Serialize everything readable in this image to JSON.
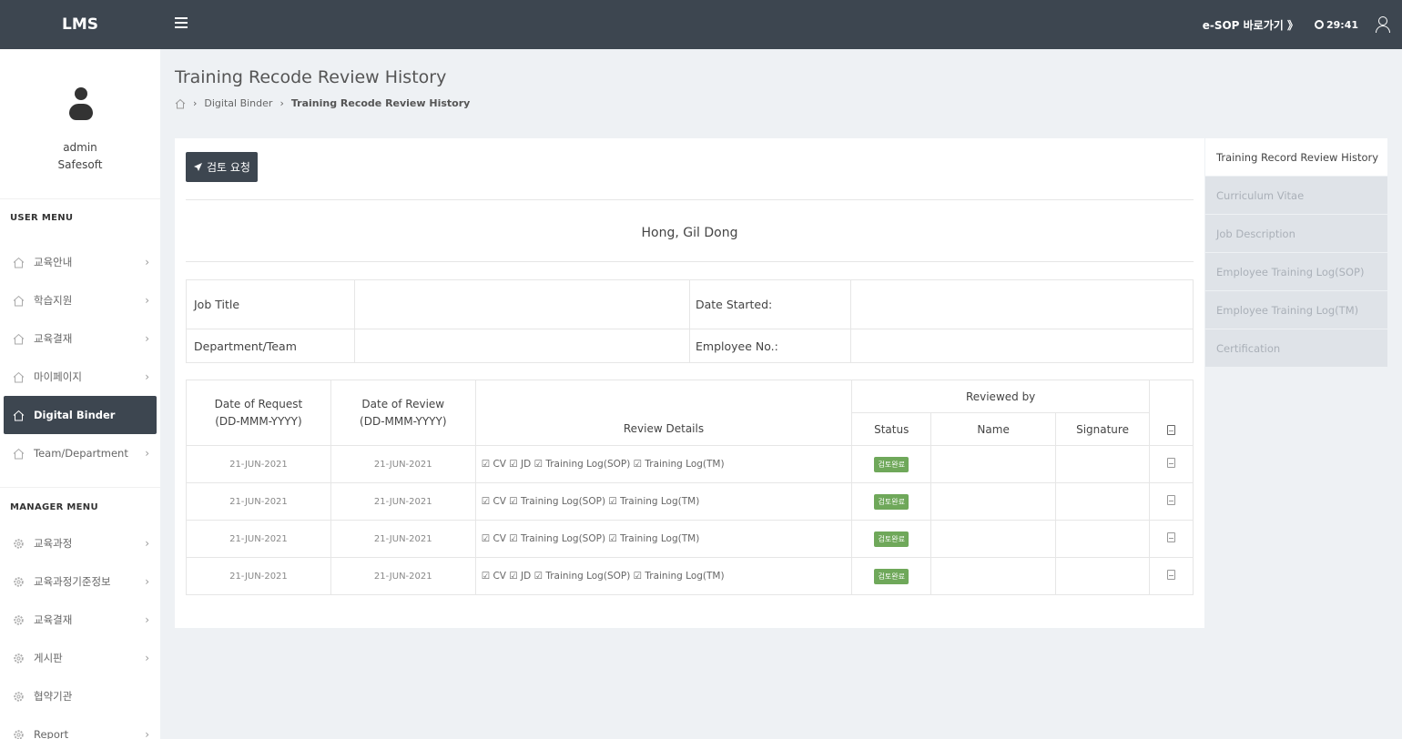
{
  "topbar": {
    "brand": "LMS",
    "esop_link": "e-SOP 바로가기 》",
    "timer": "29:41"
  },
  "sidebar": {
    "profile": {
      "name": "admin",
      "org": "Safesoft"
    },
    "user_menu_title": "USER MENU",
    "user_items": [
      {
        "label": "교육안내",
        "arrow": "›"
      },
      {
        "label": "학습지원",
        "arrow": "›"
      },
      {
        "label": "교육결재",
        "arrow": "›"
      },
      {
        "label": "마이페이지",
        "arrow": "›"
      },
      {
        "label": "Digital Binder",
        "active": true
      },
      {
        "label": "Team/Department",
        "arrow": "›"
      }
    ],
    "manager_menu_title": "MANAGER MENU",
    "manager_items": [
      {
        "label": "교육과정",
        "arrow": "›"
      },
      {
        "label": "교육과정기준정보",
        "arrow": "›"
      },
      {
        "label": "교육결재",
        "arrow": "›"
      },
      {
        "label": "게시판",
        "arrow": "›"
      },
      {
        "label": "협약기관"
      },
      {
        "label": "Report",
        "arrow": "›"
      }
    ]
  },
  "page": {
    "title": "Training Recode Review History",
    "breadcrumb": [
      "Digital Binder",
      "Training Recode Review History"
    ]
  },
  "card": {
    "request_button": "검토 요청",
    "employee_name": "Hong, Gil Dong",
    "info": {
      "job_title_label": "Job Title",
      "job_title_value": "",
      "date_started_label": "Date Started:",
      "date_started_value": "",
      "department_label": "Department/Team",
      "department_value": "",
      "employee_no_label": "Employee No.:",
      "employee_no_value": ""
    },
    "history": {
      "headers": {
        "date_request": "Date of Request",
        "date_request_fmt": "(DD-MMM-YYYY)",
        "date_review": "Date of Review",
        "date_review_fmt": "(DD-MMM-YYYY)",
        "review_details": "Review Details",
        "reviewed_by": "Reviewed by",
        "status": "Status",
        "name": "Name",
        "signature": "Signature"
      },
      "rows": [
        {
          "date_request": "21-JUN-2021",
          "date_review": "21-JUN-2021",
          "details": "☑ CV ☑ JD ☑ Training Log(SOP) ☑ Training Log(TM)",
          "status": "검토완료",
          "name": "",
          "signature": ""
        },
        {
          "date_request": "21-JUN-2021",
          "date_review": "21-JUN-2021",
          "details": "☑ CV ☑ Training Log(SOP) ☑ Training Log(TM)",
          "status": "검토완료",
          "name": "",
          "signature": ""
        },
        {
          "date_request": "21-JUN-2021",
          "date_review": "21-JUN-2021",
          "details": "☑ CV ☑ Training Log(SOP) ☑ Training Log(TM)",
          "status": "검토완료",
          "name": "",
          "signature": ""
        },
        {
          "date_request": "21-JUN-2021",
          "date_review": "21-JUN-2021",
          "details": "☑ CV ☑ JD ☑ Training Log(SOP) ☑ Training Log(TM)",
          "status": "검토완료",
          "name": "",
          "signature": ""
        }
      ]
    }
  },
  "tabs": [
    {
      "label": "Training Record Review History",
      "active": true
    },
    {
      "label": "Curriculum Vitae"
    },
    {
      "label": "Job Description"
    },
    {
      "label": "Employee Training Log(SOP)"
    },
    {
      "label": "Employee Training Log(TM)"
    },
    {
      "label": "Certification"
    }
  ],
  "colors": {
    "topbar": "#3d4650",
    "active_menu": "#3d4650",
    "badge": "#6fa85a",
    "background": "#eef1f4"
  }
}
